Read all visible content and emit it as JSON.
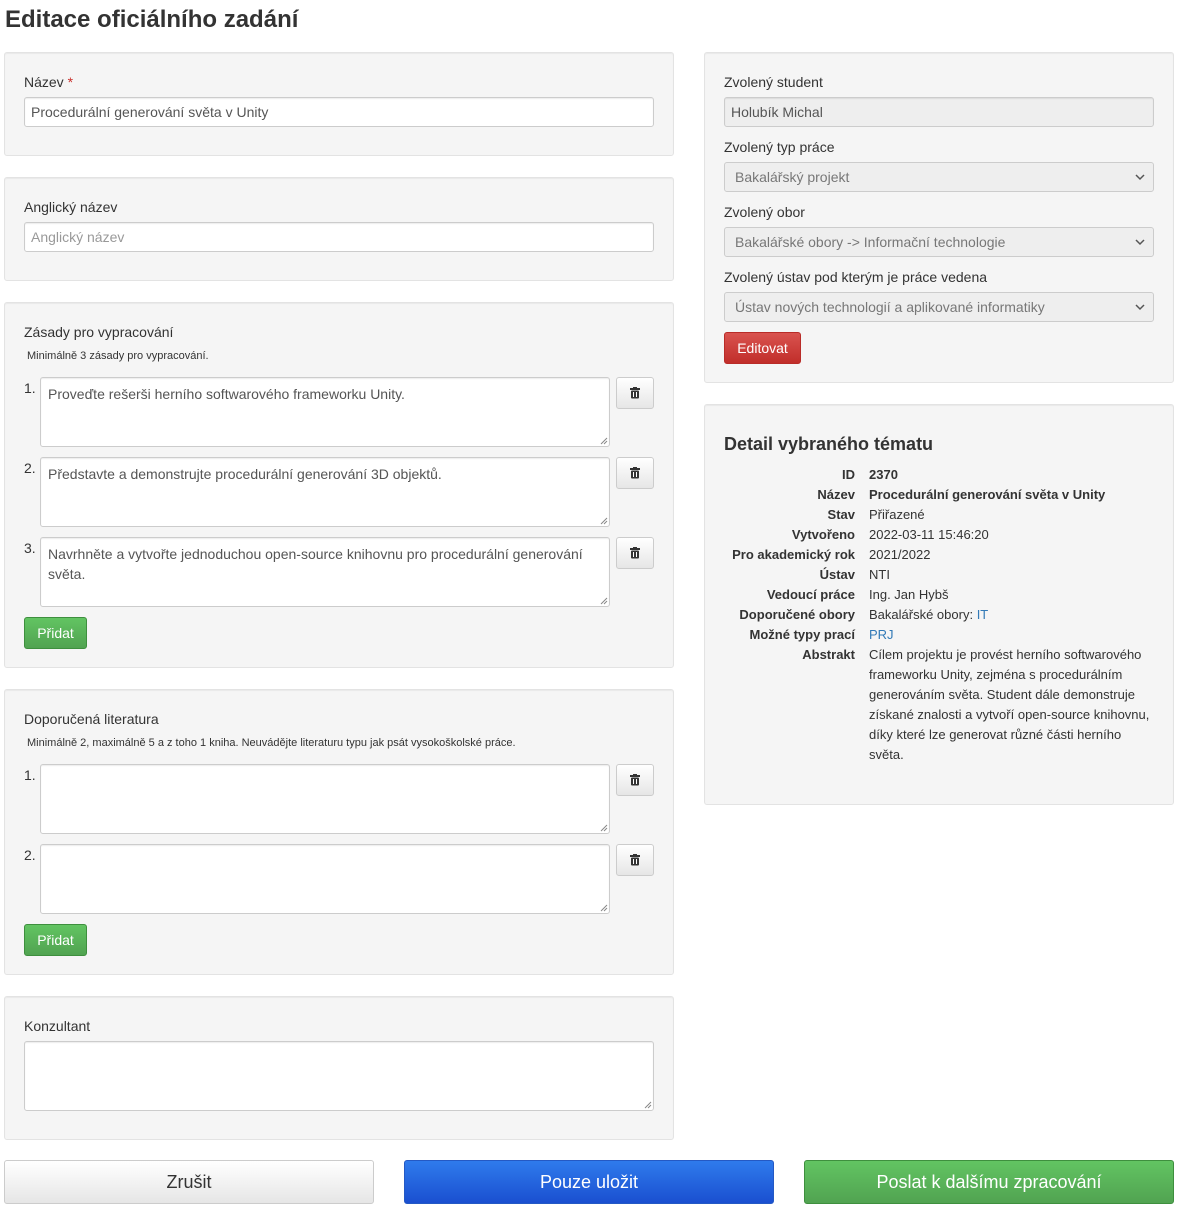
{
  "page": {
    "title": "Editace oficiálního zadání"
  },
  "nazev": {
    "label": "Název",
    "required_mark": "*",
    "value": "Procedurální generování světa v Unity"
  },
  "anglicky_nazev": {
    "label": "Anglický název",
    "placeholder": "Anglický název"
  },
  "zasady": {
    "label": "Zásady pro vypracování",
    "hint": "Minimálně 3 zásady pro vypracování.",
    "items": [
      {
        "num": "1.",
        "text": "Proveďte rešerši herního softwarového frameworku Unity."
      },
      {
        "num": "2.",
        "text": "Představte a demonstrujte procedurální generování 3D objektů."
      },
      {
        "num": "3.",
        "text": "Navrhněte a vytvořte jednoduchou open-source knihovnu pro procedurální generování světa."
      }
    ],
    "add_label": "Přidat"
  },
  "literatura": {
    "label": "Doporučená literatura",
    "hint": "Minimálně 2, maximálně 5 a z toho 1 kniha. Neuvádějte literaturu typu jak psát vysokoškolské práce.",
    "items": [
      {
        "num": "1.",
        "text": ""
      },
      {
        "num": "2.",
        "text": ""
      }
    ],
    "add_label": "Přidat"
  },
  "konzultant": {
    "label": "Konzultant",
    "value": ""
  },
  "side": {
    "student_label": "Zvolený student",
    "student_value": "Holubík Michal",
    "typ_label": "Zvolený typ práce",
    "typ_value": "Bakalářský projekt",
    "obor_label": "Zvolený obor",
    "obor_value": "Bakalářské obory -> Informační technologie",
    "ustav_label": "Zvolený ústav pod kterým je práce vedena",
    "ustav_value": "Ústav nových technologií a aplikované informatiky",
    "edit_label": "Editovat"
  },
  "detail": {
    "title": "Detail vybraného tématu",
    "rows": {
      "id": {
        "k": "ID",
        "v": "2370"
      },
      "nazev": {
        "k": "Název",
        "v": "Procedurální generování světa v Unity"
      },
      "stav": {
        "k": "Stav",
        "v": "Přiřazené"
      },
      "vytvoreno": {
        "k": "Vytvořeno",
        "v": "2022-03-11 15:46:20"
      },
      "rok": {
        "k": "Pro akademický rok",
        "v": "2021/2022"
      },
      "ustav": {
        "k": "Ústav",
        "v": "NTI"
      },
      "vedouci": {
        "k": "Vedoucí práce",
        "v": "Ing. Jan Hybš"
      },
      "obory": {
        "k": "Doporučené obory",
        "v": "Bakalářské obory:",
        "link": "IT"
      },
      "typy": {
        "k": "Možné typy prací",
        "link": "PRJ"
      },
      "abstrakt": {
        "k": "Abstrakt",
        "v": "Cílem projektu je provést herního softwarového frameworku Unity, zejména s procedurálním generováním světa. Student dále demonstruje získané znalosti a vytvoří open-source knihovnu, díky které lze generovat různé části herního světa."
      }
    }
  },
  "actions": {
    "cancel": "Zrušit",
    "save": "Pouze uložit",
    "send": "Poslat k dalšímu zpracování"
  },
  "icons": {
    "trash": "trash-icon",
    "chevron": "chevron-down-icon",
    "resize": "resize-grip-icon"
  }
}
